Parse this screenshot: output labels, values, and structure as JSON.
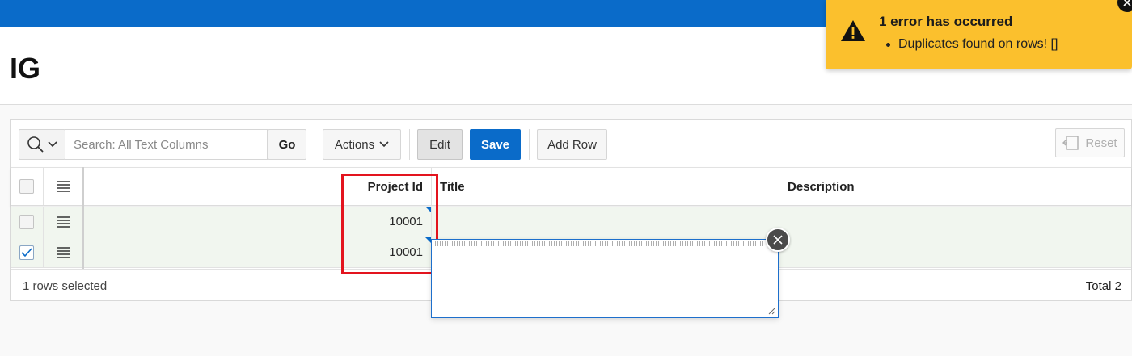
{
  "page": {
    "title": "IG"
  },
  "colors": {
    "header_bar": "#0a6bc9",
    "primary": "#0a6bc9",
    "alert_bg": "#fbc02d",
    "highlight": "#e3141e",
    "row_bg": "#f1f6ef"
  },
  "toolbar": {
    "search_menu_icon": "search-icon",
    "search_placeholder": "Search: All Text Columns",
    "go_label": "Go",
    "actions_label": "Actions",
    "edit_label": "Edit",
    "save_label": "Save",
    "add_row_label": "Add Row",
    "reset_label": "Reset"
  },
  "grid": {
    "columns": [
      "Project Id",
      "Title",
      "Description"
    ],
    "rows": [
      {
        "selected": false,
        "project_id": "10001",
        "title": "",
        "description": ""
      },
      {
        "selected": true,
        "project_id": "10001",
        "title": "",
        "description": ""
      }
    ],
    "footer": {
      "selection": "1 rows selected",
      "total": "Total 2"
    }
  },
  "alert": {
    "title": "1 error has occurred",
    "messages": [
      "Duplicates found on rows! []"
    ],
    "icon": "warning-icon"
  }
}
